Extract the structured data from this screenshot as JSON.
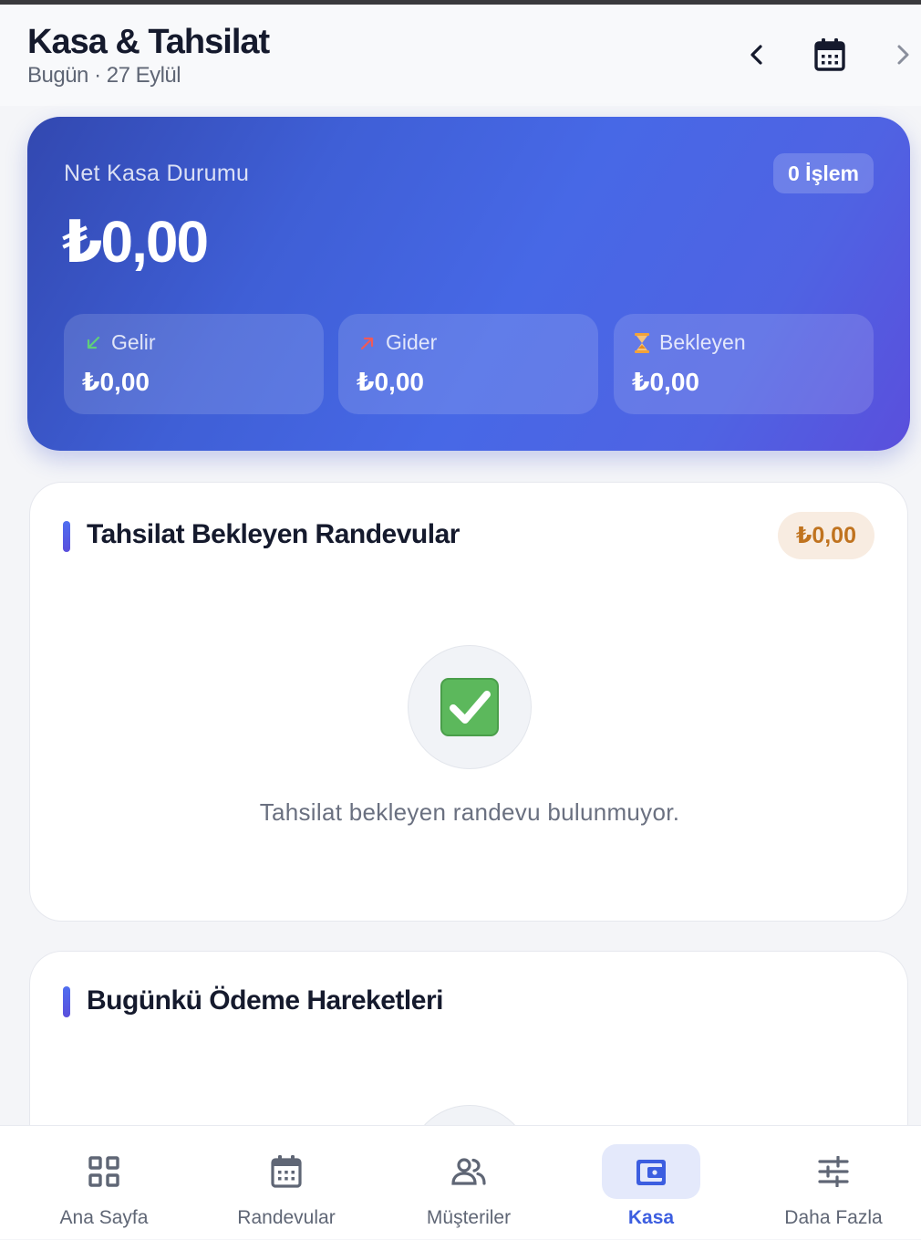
{
  "header": {
    "title": "Kasa & Tahsilat",
    "subtitle": "Bugün · 27 Eylül"
  },
  "hero": {
    "label": "Net Kasa Durumu",
    "count_badge": "0 İşlem",
    "amount": "₺0,00",
    "stats": [
      {
        "label": "Gelir",
        "value": "₺0,00",
        "icon": "arrow-down-left-icon"
      },
      {
        "label": "Gider",
        "value": "₺0,00",
        "icon": "arrow-up-right-icon"
      },
      {
        "label": "Bekleyen",
        "value": "₺0,00",
        "icon": "hourglass-icon"
      }
    ]
  },
  "pending_card": {
    "title": "Tahsilat Bekleyen Randevular",
    "badge": "₺0,00",
    "empty_text": "Tahsilat bekleyen randevu bulunmuyor."
  },
  "payments_card": {
    "title": "Bugünkü Ödeme Hareketleri"
  },
  "bottom_nav": {
    "items": [
      {
        "label": "Ana Sayfa",
        "icon": "grid-icon"
      },
      {
        "label": "Randevular",
        "icon": "calendar-icon"
      },
      {
        "label": "Müşteriler",
        "icon": "users-icon"
      },
      {
        "label": "Kasa",
        "icon": "wallet-icon",
        "active": true
      },
      {
        "label": "Daha Fazla",
        "icon": "sliders-icon"
      }
    ]
  },
  "colors": {
    "accent": "#3c5ee0",
    "pending_badge_bg": "#f8ece1",
    "pending_badge_text": "#c0731f",
    "income_arrow": "#5fcf7a",
    "expense_arrow": "#ef5a5a",
    "hourglass": "#f2a23a"
  }
}
